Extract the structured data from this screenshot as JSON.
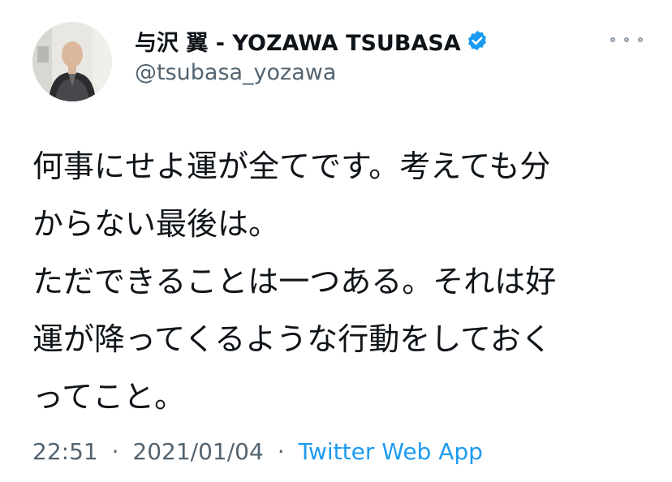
{
  "user": {
    "display_name": "与沢 翼 - YOZAWA TSUBASA",
    "handle": "@tsubasa_yozawa",
    "verified": true,
    "verified_color": "#1d9bf0"
  },
  "tweet": {
    "lines": [
      "何事にせよ運が全てです。考えても分",
      "からない最後は。",
      "ただできることは一つある。それは好",
      "運が降ってくるような行動をしておく",
      "ってこと。"
    ]
  },
  "meta": {
    "time": "22:51",
    "separator": "·",
    "date": "2021/01/04",
    "source": "Twitter Web App"
  },
  "icons": {
    "avatar": "profile-photo",
    "verified": "verified-badge-icon",
    "more": "more-options-icon"
  },
  "colors": {
    "text": "#0f1419",
    "secondary": "#536471",
    "link": "#1d9bf0"
  }
}
